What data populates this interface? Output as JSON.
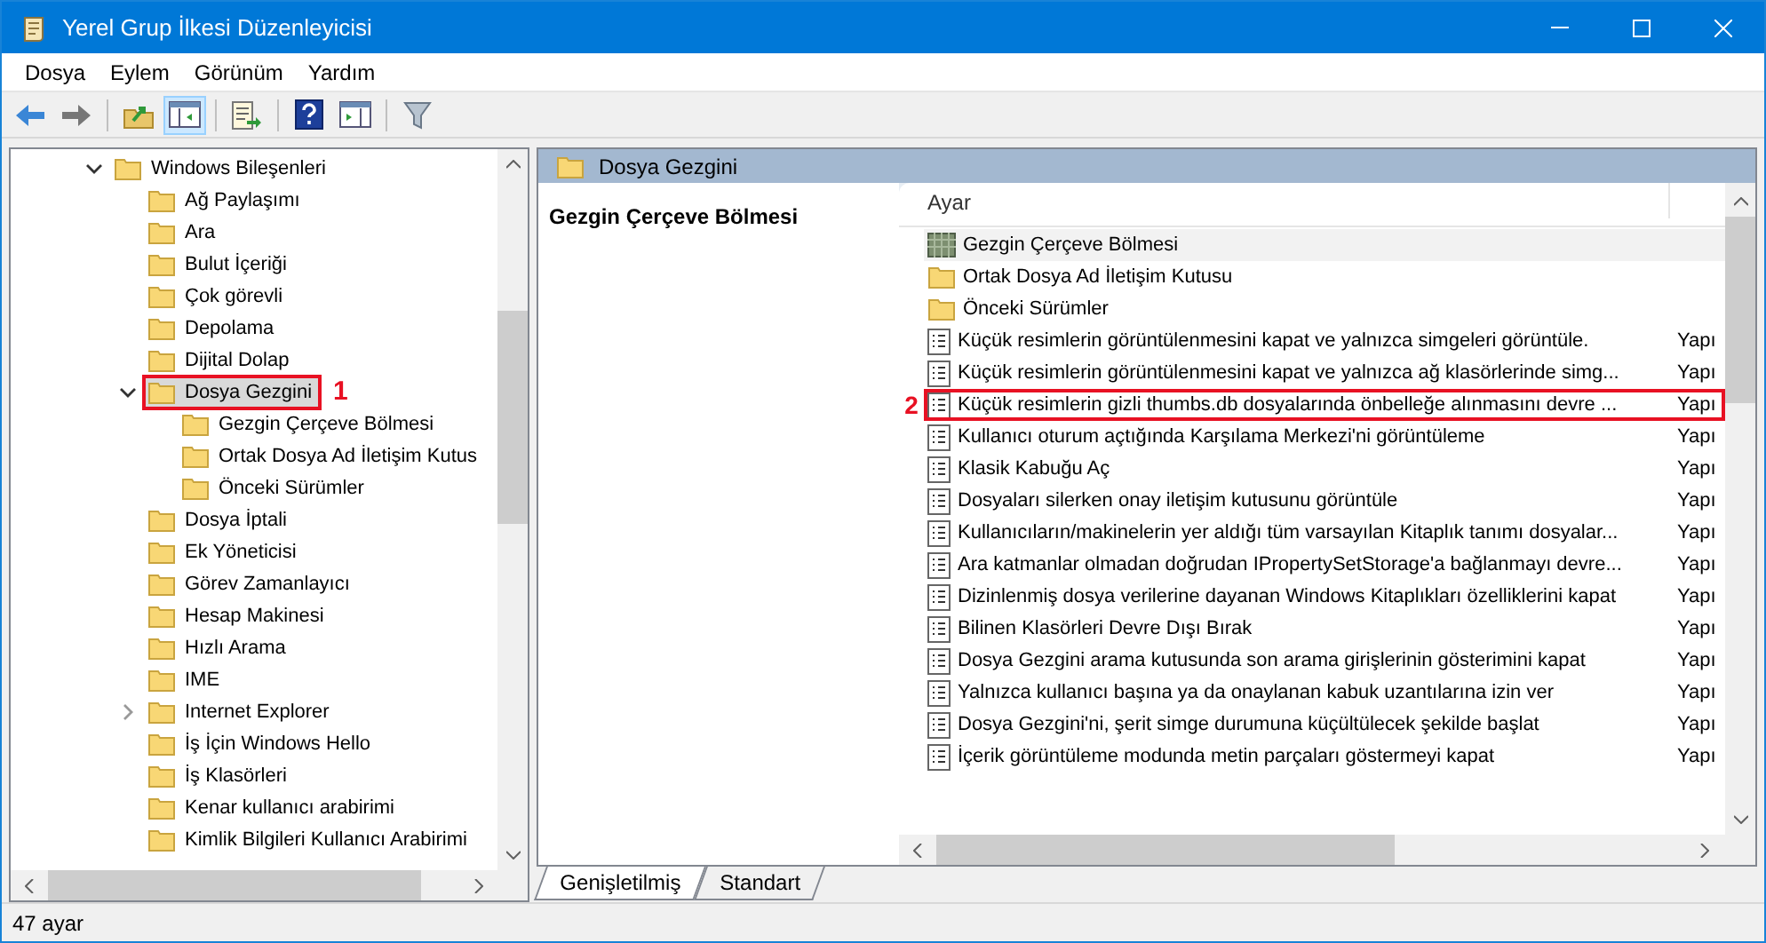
{
  "window": {
    "title": "Yerel Grup İlkesi Düzenleyicisi"
  },
  "menu": [
    "Dosya",
    "Eylem",
    "Görünüm",
    "Yardım"
  ],
  "toolbar": [
    {
      "kind": "back",
      "pressed": false
    },
    {
      "kind": "forward",
      "pressed": false
    },
    {
      "kind": "sep"
    },
    {
      "kind": "up",
      "pressed": false
    },
    {
      "kind": "tree",
      "pressed": true
    },
    {
      "kind": "sep"
    },
    {
      "kind": "export",
      "pressed": false
    },
    {
      "kind": "sep"
    },
    {
      "kind": "help",
      "pressed": false
    },
    {
      "kind": "view",
      "pressed": false
    },
    {
      "kind": "sep"
    },
    {
      "kind": "filter",
      "pressed": false
    }
  ],
  "tree": [
    {
      "label": "Windows Bileşenleri",
      "expanded": true,
      "selected": false,
      "children": [
        {
          "label": "Ağ Paylaşımı",
          "selected": false
        },
        {
          "label": "Ara",
          "selected": false
        },
        {
          "label": "Bulut İçeriği",
          "selected": false
        },
        {
          "label": "Çok görevli",
          "selected": false
        },
        {
          "label": "Depolama",
          "selected": false
        },
        {
          "label": "Dijital Dolap",
          "selected": false
        },
        {
          "label": "Dosya Gezgini",
          "expanded": true,
          "selected": true,
          "annotation": "1",
          "children": [
            {
              "label": "Gezgin Çerçeve Bölmesi",
              "selected": false
            },
            {
              "label": "Ortak Dosya Ad İletişim Kutus",
              "selected": false
            },
            {
              "label": "Önceki Sürümler",
              "selected": false
            }
          ]
        },
        {
          "label": "Dosya İptali",
          "selected": false
        },
        {
          "label": "Ek Yöneticisi",
          "selected": false
        },
        {
          "label": "Görev Zamanlayıcı",
          "selected": false
        },
        {
          "label": "Hesap Makinesi",
          "selected": false
        },
        {
          "label": "Hızlı Arama",
          "selected": false
        },
        {
          "label": "IME",
          "selected": false
        },
        {
          "label": "Internet Explorer",
          "expanded": false,
          "selected": false
        },
        {
          "label": "İş İçin Windows Hello",
          "selected": false
        },
        {
          "label": "İş Klasörleri",
          "selected": false
        },
        {
          "label": "Kenar kullanıcı arabirimi",
          "selected": false
        },
        {
          "label": "Kimlik Bilgileri Kullanıcı Arabirimi",
          "selected": false
        }
      ]
    }
  ],
  "details": {
    "header": "Dosya Gezgini",
    "description_title": "Gezgin Çerçeve Bölmesi"
  },
  "table": {
    "columns": [
      "Ayar"
    ],
    "rows": [
      {
        "kind": "pane",
        "name": "Gezgin Çerçeve Bölmesi",
        "selected": true
      },
      {
        "kind": "folder",
        "name": "Ortak Dosya Ad İletişim Kutusu",
        "selected": false
      },
      {
        "kind": "folder",
        "name": "Önceki Sürümler",
        "selected": false
      },
      {
        "kind": "policy",
        "name": "Küçük resimlerin görüntülenmesini kapat ve yalnızca simgeleri görüntüle.",
        "state": "Yapı",
        "selected": false
      },
      {
        "kind": "policy",
        "name": "Küçük resimlerin görüntülenmesini kapat ve yalnızca ağ klasörlerinde simg...",
        "state": "Yapı",
        "selected": false
      },
      {
        "kind": "policy",
        "name": "Küçük resimlerin gizli thumbs.db dosyalarında önbelleğe alınmasını devre ...",
        "state": "Yapı",
        "selected": false,
        "annotation": "2"
      },
      {
        "kind": "policy",
        "name": "Kullanıcı oturum açtığında Karşılama Merkezi'ni görüntüleme",
        "state": "Yapı",
        "selected": false
      },
      {
        "kind": "policy",
        "name": "Klasik Kabuğu Aç",
        "state": "Yapı",
        "selected": false
      },
      {
        "kind": "policy",
        "name": "Dosyaları silerken onay iletişim kutusunu görüntüle",
        "state": "Yapı",
        "selected": false
      },
      {
        "kind": "policy",
        "name": "Kullanıcıların/makinelerin yer aldığı tüm varsayılan Kitaplık tanımı dosyalar...",
        "state": "Yapı",
        "selected": false
      },
      {
        "kind": "policy",
        "name": "Ara katmanlar olmadan doğrudan IPropertySetStorage'a bağlanmayı devre...",
        "state": "Yapı",
        "selected": false
      },
      {
        "kind": "policy",
        "name": "Dizinlenmiş dosya verilerine dayanan Windows Kitaplıkları özelliklerini kapat",
        "state": "Yapı",
        "selected": false
      },
      {
        "kind": "policy",
        "name": "Bilinen Klasörleri Devre Dışı Bırak",
        "state": "Yapı",
        "selected": false
      },
      {
        "kind": "policy",
        "name": "Dosya Gezgini arama kutusunda son arama girişlerinin gösterimini kapat",
        "state": "Yapı",
        "selected": false
      },
      {
        "kind": "policy",
        "name": "Yalnızca kullanıcı başına ya da onaylanan kabuk uzantılarına izin ver",
        "state": "Yapı",
        "selected": false
      },
      {
        "kind": "policy",
        "name": "Dosya Gezgini'ni, şerit simge durumuna küçültülecek şekilde başlat",
        "state": "Yapı",
        "selected": false
      },
      {
        "kind": "policy",
        "name": "İçerik görüntüleme modunda metin parçaları göstermeyi kapat",
        "state": "Yapı",
        "selected": false
      }
    ]
  },
  "tabs": [
    {
      "label": "Genişletilmiş",
      "selected": true
    },
    {
      "label": "Standart",
      "selected": false
    }
  ],
  "status_bar": "47 ayar"
}
